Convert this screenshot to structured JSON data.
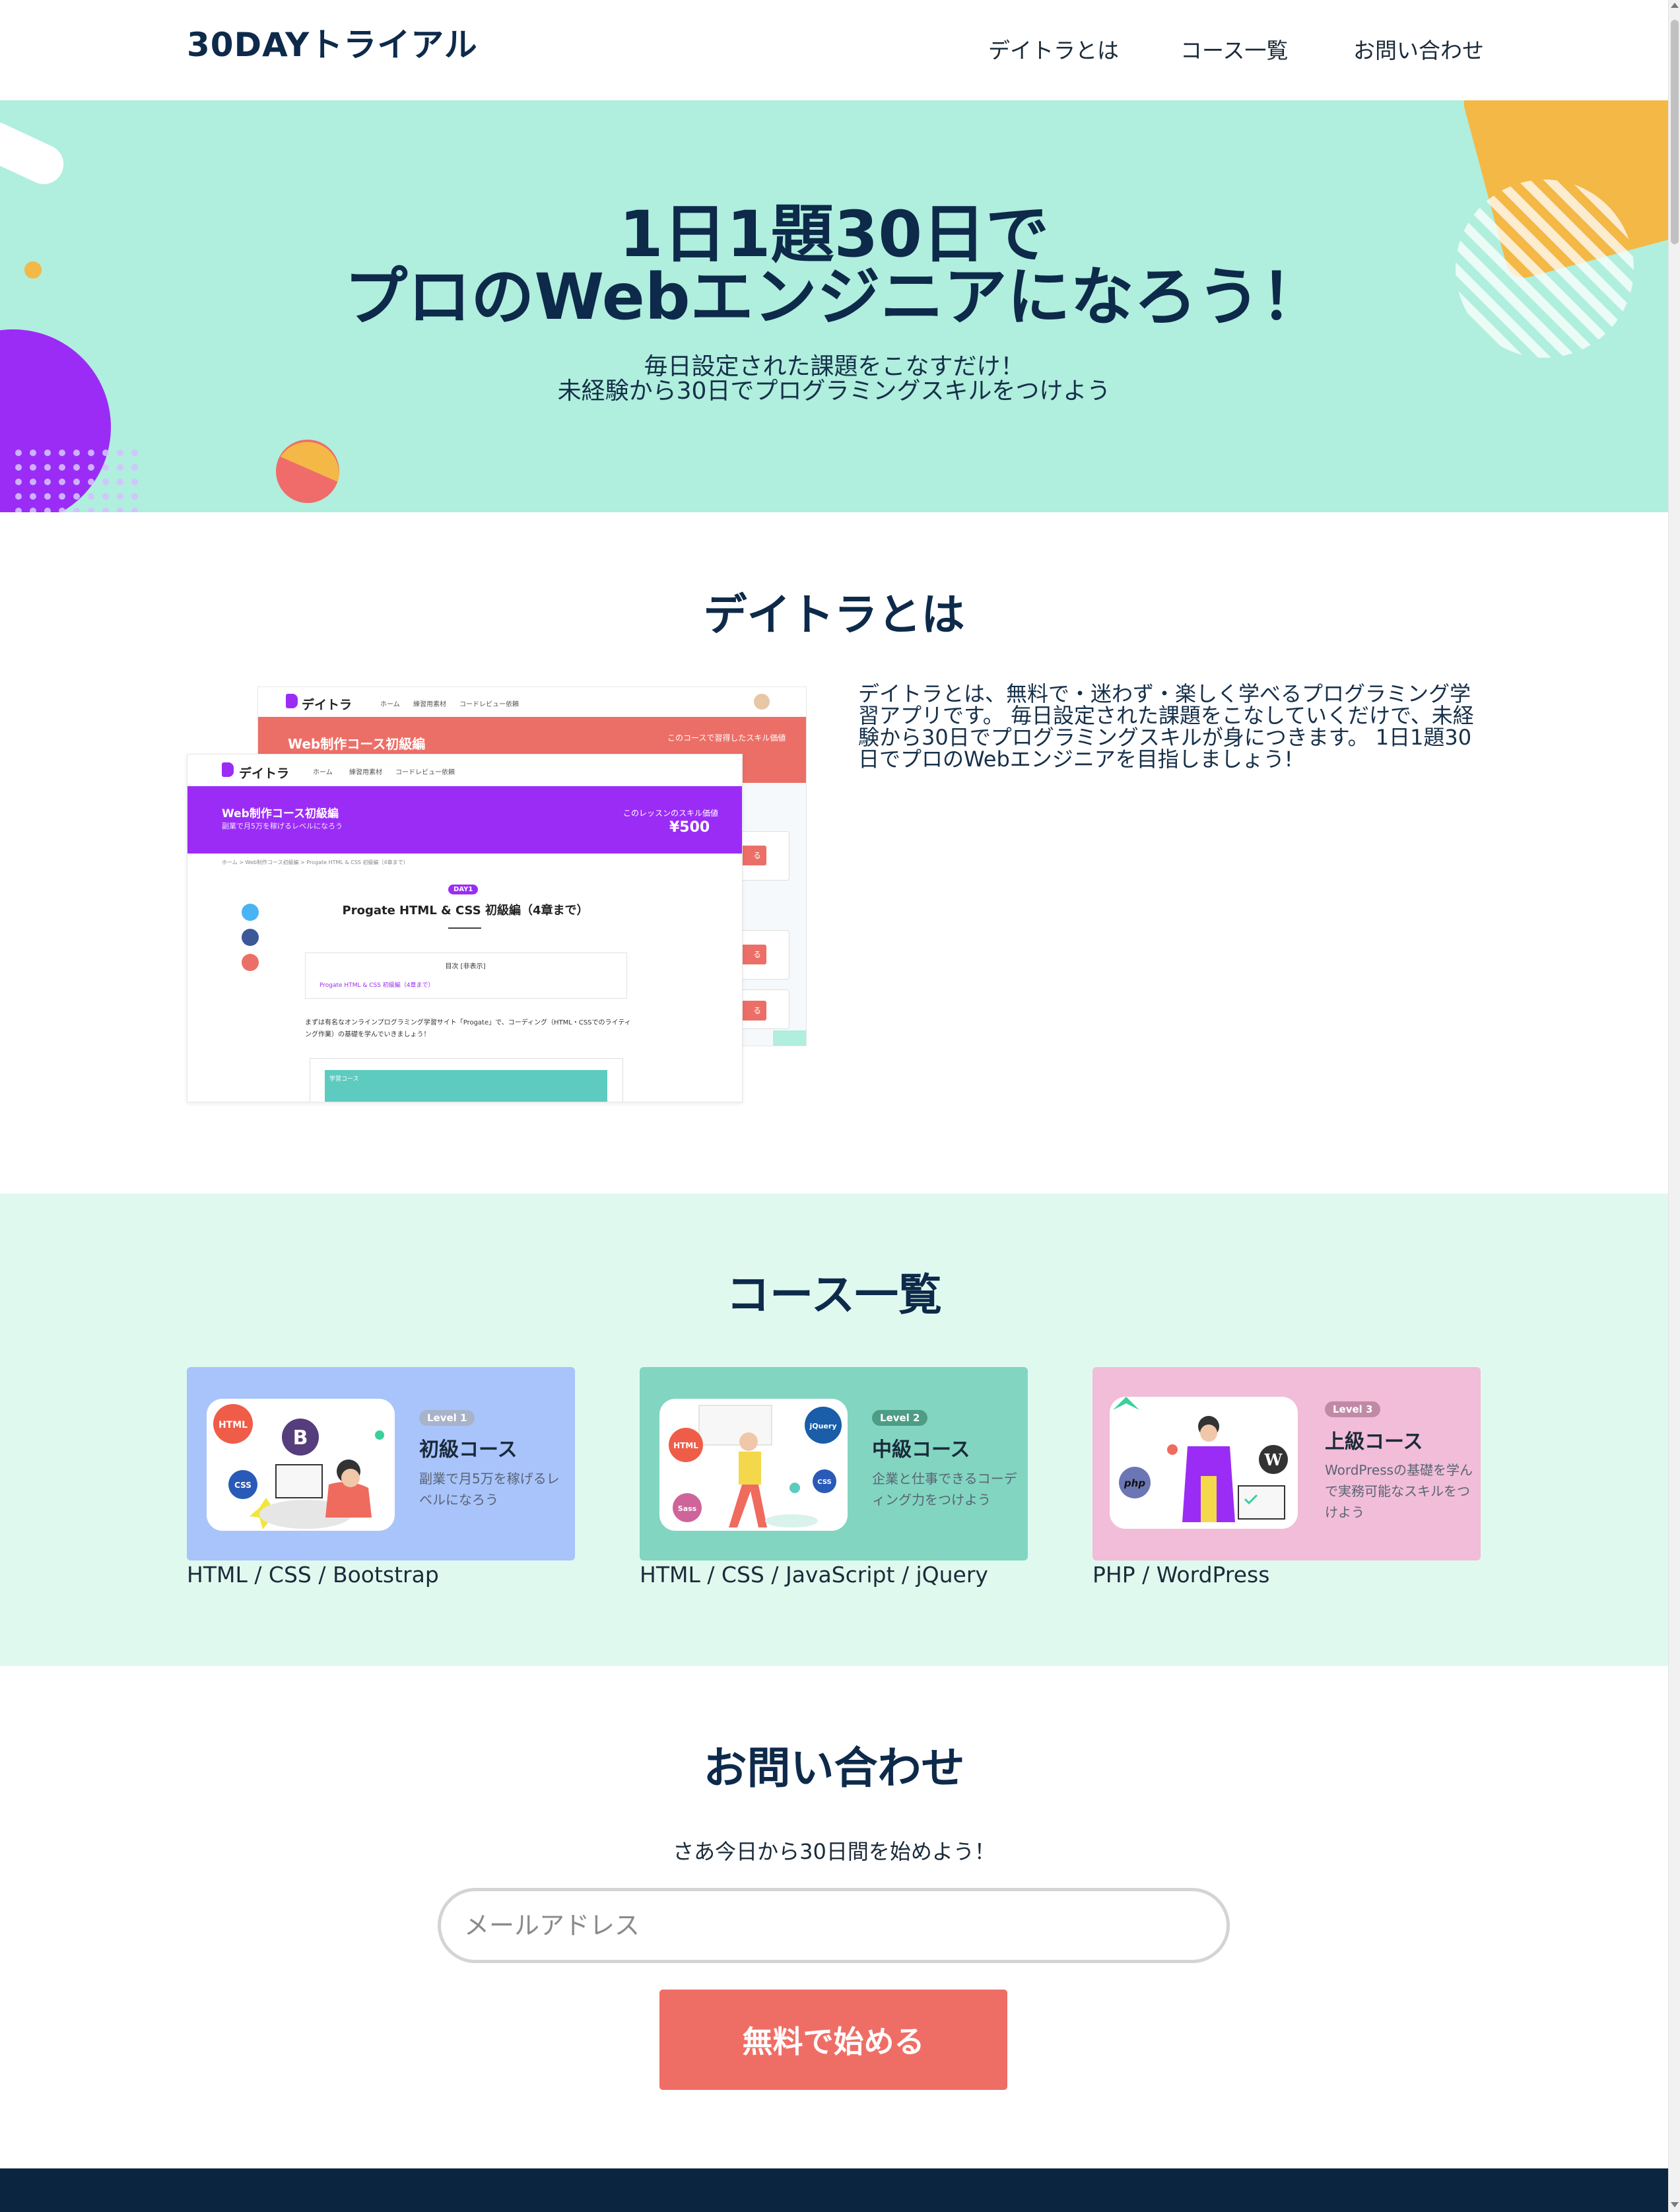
{
  "header": {
    "logo": "30DAYトライアル",
    "nav": [
      {
        "label": "デイトラとは"
      },
      {
        "label": "コース一覧"
      },
      {
        "label": "お問い合わせ"
      }
    ]
  },
  "hero": {
    "title_line1": "1日1題30日で",
    "title_line2": "プロのWebエンジニアになろう！",
    "sub_line1": "毎日設定された課題をこなすだけ！",
    "sub_line2": "未経験から30日でプログラミングスキルをつけよう"
  },
  "about": {
    "title": "デイトラとは",
    "description": "デイトラとは、無料で・迷わず・楽しく学べるプログラミング学習アプリです。 毎日設定された課題をこなしていくだけで、未経験から30日でプログラミングスキルが身につきます。 1日1題30日でプロのWebエンジニアを目指しましょう!",
    "mockup": {
      "back": {
        "brand": "デイトラ",
        "nav": [
          "ホーム",
          "練習用素材",
          "コードレビュー依頼"
        ],
        "banner_title": "Web制作コース初級編",
        "banner_right": "このコースで習得したスキル価値",
        "button_text": "る"
      },
      "front": {
        "brand": "デイトラ",
        "nav": [
          "ホーム",
          "練習用素材",
          "コードレビュー依頼"
        ],
        "banner_title": "Web制作コース初級編",
        "banner_sub": "副業で月5万を稼げるレベルになろう",
        "banner_right": "このレッスンのスキル価値",
        "price": "¥500",
        "breadcrumb": "ホーム > Web制作コース初級編 > Progate HTML & CSS 初級編（4章まで）",
        "day_badge": "DAY1",
        "lesson_title": "Progate HTML & CSS 初級編（4章まで）",
        "toc_label": "目次 [非表示]",
        "toc_item": "Progate HTML & CSS 初級編（4章まで）",
        "body_text": "まずは有名なオンラインプログラミング学習サイト「Progate」で、コーディング（HTML・CSSでのライティング作業）の基礎を学んでいきましょう！",
        "box_label": "学習コース"
      }
    }
  },
  "courses": {
    "title": "コース一覧",
    "items": [
      {
        "level": "Level 1",
        "name": "初級コース",
        "desc": "副業で月5万を稼げるレベルになろう",
        "tags": "HTML / CSS / Bootstrap",
        "bg": "#a8c4fb",
        "badge": "#a8b3c9",
        "logos": [
          "HTML",
          "B",
          "CSS"
        ]
      },
      {
        "level": "Level 2",
        "name": "中級コース",
        "desc": "企業と仕事できるコーディング力をつけよう",
        "tags": "HTML / CSS / JavaScript / jQuery",
        "bg": "#82d5c1",
        "badge": "#4d9c85",
        "logos": [
          "HTML",
          "jQuery",
          "Sass",
          "CSS"
        ]
      },
      {
        "level": "Level 3",
        "name": "上級コース",
        "desc": "WordPressの基礎を学んで実務可能なスキルをつけよう",
        "tags": "PHP / WordPress",
        "bg": "#f1bdd8",
        "badge": "#c08aa6",
        "logos": [
          "php",
          "W"
        ]
      }
    ]
  },
  "contact": {
    "title": "お問い合わせ",
    "subtitle": "さあ今日から30日間を始めよう！",
    "email_placeholder": "メールアドレス",
    "button": "無料で始める"
  },
  "colors": {
    "navy": "#0d2a4a",
    "hero_bg": "#b0eedd",
    "courses_bg": "#e0f9ef",
    "cta": "#ee6e66",
    "footer": "#0b2440",
    "purple": "#9b2cf5",
    "coral": "#ee6e66"
  }
}
